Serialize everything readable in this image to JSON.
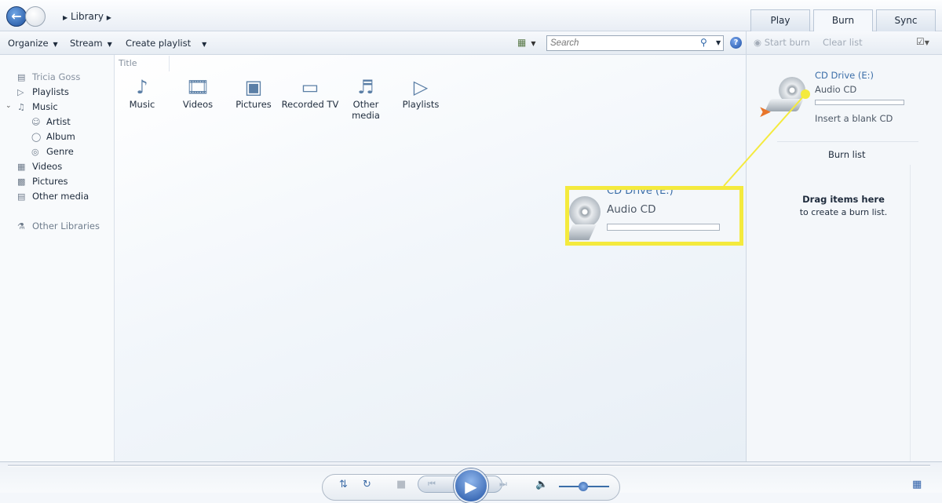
{
  "nav": {
    "breadcrumb": "Library"
  },
  "tabs": [
    {
      "label": "Play"
    },
    {
      "label": "Burn"
    },
    {
      "label": "Sync"
    }
  ],
  "toolbar": {
    "organize": "Organize",
    "stream": "Stream",
    "create_playlist": "Create playlist",
    "search_placeholder": "Search",
    "help": "?"
  },
  "sidebar": {
    "items": [
      {
        "label": "Tricia Goss",
        "icon": "library-icon"
      },
      {
        "label": "Playlists",
        "icon": "playlist-icon"
      },
      {
        "label": "Music",
        "icon": "music-icon"
      },
      {
        "label": "Artist",
        "icon": "artist-icon"
      },
      {
        "label": "Album",
        "icon": "album-icon"
      },
      {
        "label": "Genre",
        "icon": "genre-icon"
      },
      {
        "label": "Videos",
        "icon": "video-icon"
      },
      {
        "label": "Pictures",
        "icon": "picture-icon"
      },
      {
        "label": "Other media",
        "icon": "media-icon"
      },
      {
        "label": "Other Libraries",
        "icon": "libraries-icon"
      }
    ]
  },
  "main": {
    "column": "Title",
    "tiles": [
      {
        "label": "Music"
      },
      {
        "label": "Videos"
      },
      {
        "label": "Pictures"
      },
      {
        "label": "Recorded TV"
      },
      {
        "label": "Other media"
      },
      {
        "label": "Playlists"
      }
    ]
  },
  "burn": {
    "start_burn": "Start burn",
    "clear_list": "Clear list",
    "drive": "CD Drive (E:)",
    "disc_type": "Audio CD",
    "status": "Insert a blank CD",
    "progress": 0,
    "burn_list": "Burn list",
    "drag_title": "Drag items here",
    "drag_sub": "to create a burn list."
  },
  "callout": {
    "drive": "CD Drive (E:)",
    "disc_type": "Audio CD",
    "color": "#f4ea3d"
  }
}
